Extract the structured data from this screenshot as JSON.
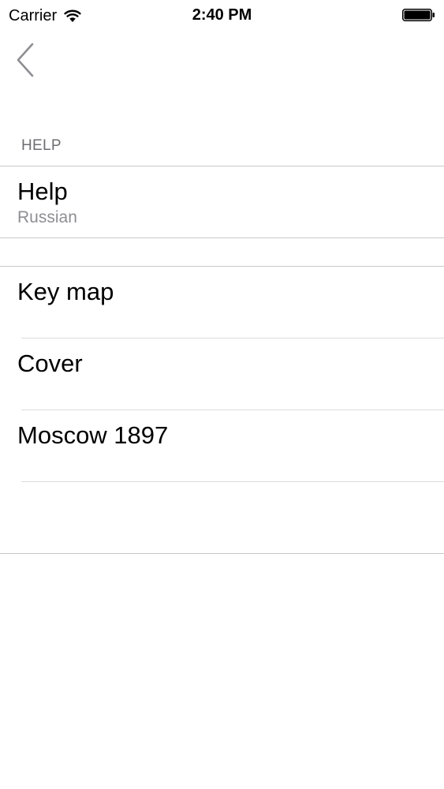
{
  "status_bar": {
    "carrier": "Carrier",
    "time": "2:40 PM",
    "wifi_icon": "wifi-icon",
    "battery_icon": "battery-icon"
  },
  "nav": {
    "back_icon": "chevron-left-icon"
  },
  "sections": [
    {
      "header": "HELP",
      "items": [
        {
          "title": "Help",
          "subtitle": "Russian"
        }
      ]
    },
    {
      "header": "",
      "items": [
        {
          "title": "Key map"
        },
        {
          "title": "Cover"
        },
        {
          "title": "Moscow 1897"
        }
      ]
    }
  ],
  "colors": {
    "separator": "#c8c7cc",
    "section_header": "#6d6d72",
    "subtitle": "#8e8e93",
    "back_chevron": "#8e8e93"
  }
}
